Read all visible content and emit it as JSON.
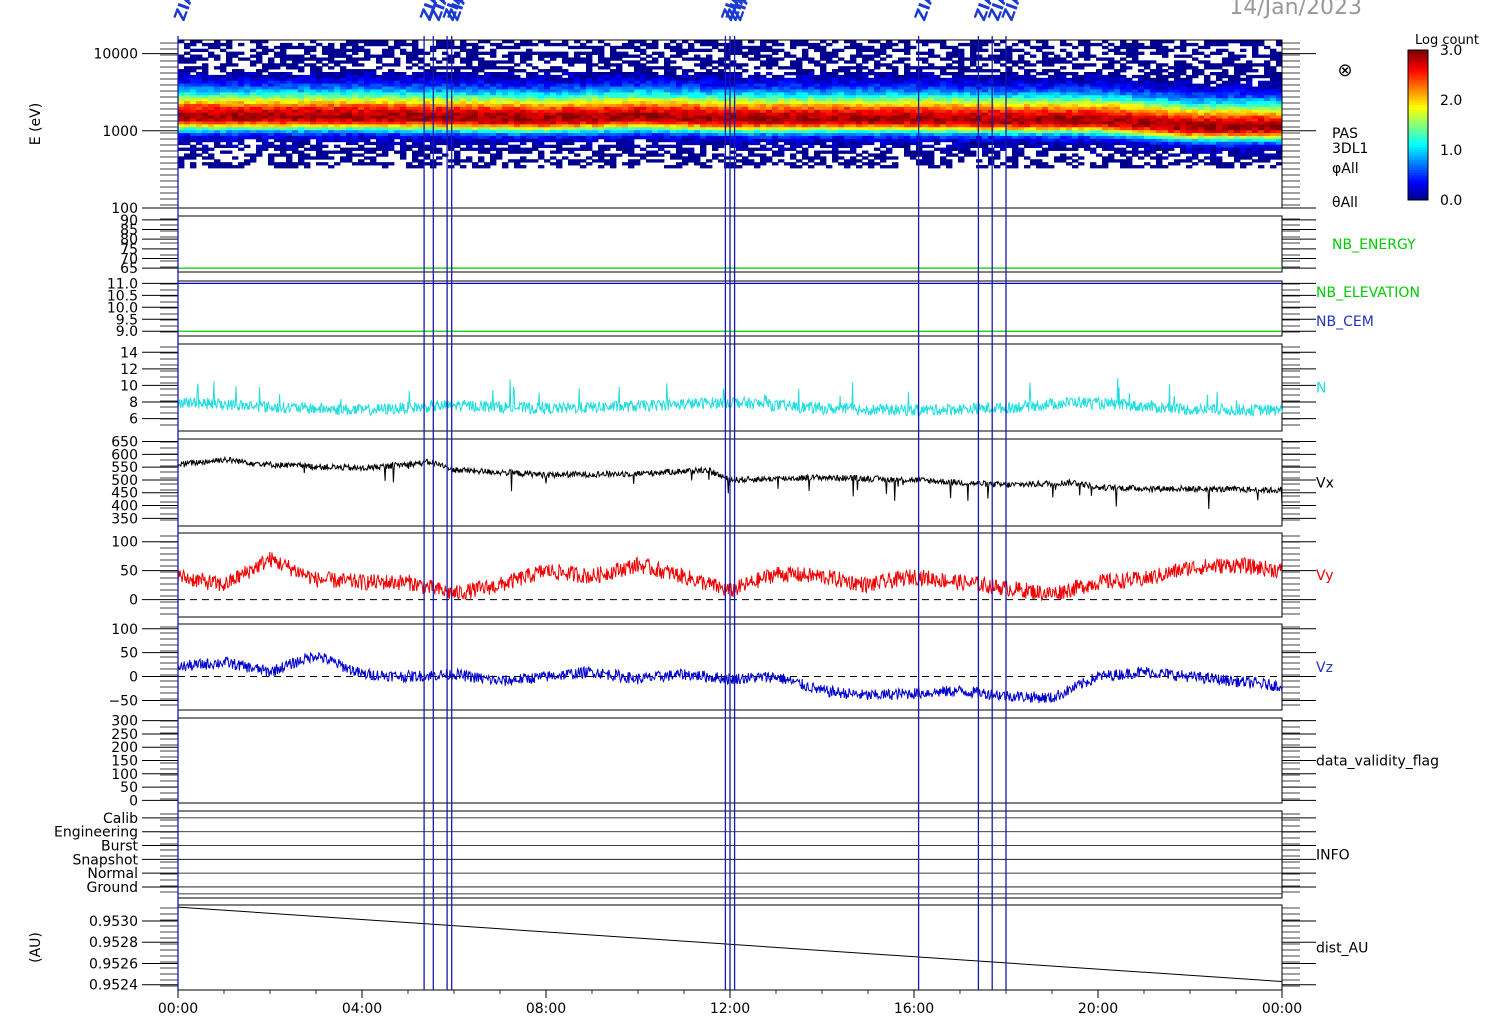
{
  "chart_data": {
    "type": "line",
    "date": "14/Jan/2023",
    "x_ticks": [
      "00:00",
      "04:00",
      "08:00",
      "12:00",
      "16:00",
      "20:00",
      "00:00"
    ],
    "x_range_hours": [
      0,
      24
    ],
    "events": [
      {
        "hour": 0.0,
        "label": "ZIAS"
      },
      {
        "hour": 5.35,
        "label": "ZIAS"
      },
      {
        "hour": 5.55,
        "label": "ZIAS"
      },
      {
        "hour": 5.85,
        "label": "ZIAS"
      },
      {
        "hour": 5.95,
        "label": "ZIAS"
      },
      {
        "hour": 11.9,
        "label": "ZIAS"
      },
      {
        "hour": 12.0,
        "label": "ZIAS"
      },
      {
        "hour": 12.1,
        "label": "ZIAS"
      },
      {
        "hour": 16.1,
        "label": "ZIAS"
      },
      {
        "hour": 17.4,
        "label": "ZIAS"
      },
      {
        "hour": 17.7,
        "label": "ZIAS"
      },
      {
        "hour": 18.0,
        "label": "ZIAS"
      }
    ],
    "colorbar": {
      "title": "Log count",
      "ticks": [
        "3.0",
        "2.0",
        "1.0",
        "0.0"
      ],
      "range": [
        0,
        3
      ]
    },
    "panels": [
      {
        "id": "spectrogram",
        "type": "heatmap",
        "ylabel": "E (eV)",
        "scale": "log",
        "ylim": [
          100,
          15000
        ],
        "ticks": [
          {
            "v": 10000,
            "t": "10000"
          },
          {
            "v": 1000,
            "t": "1000"
          },
          {
            "v": 100,
            "t": "100"
          }
        ],
        "peak_energy_ev": [
          1500,
          1500,
          1500,
          1450,
          1400,
          1500,
          1400,
          1400,
          1400,
          1350,
          1350,
          1100,
          1100
        ],
        "right_labels": [
          "PAS",
          "3DL1",
          "φAll",
          "θAll"
        ],
        "icon": "⊗"
      },
      {
        "id": "nb_energy",
        "ylim": [
          63,
          92
        ],
        "ticks": [
          {
            "v": 90,
            "t": "90"
          },
          {
            "v": 85,
            "t": "85"
          },
          {
            "v": 80,
            "t": "80"
          },
          {
            "v": 75,
            "t": "75"
          },
          {
            "v": 70,
            "t": "70"
          },
          {
            "v": 65,
            "t": "65"
          }
        ],
        "series": [
          {
            "name": "NB_ENERGY",
            "color": "#00cc00",
            "constant": 65
          }
        ],
        "right_labels": [
          {
            "text": "NB_ENERGY",
            "color": "#00cc00"
          }
        ]
      },
      {
        "id": "nb_elev",
        "ylim": [
          8.8,
          11.1
        ],
        "ticks": [
          {
            "v": 11.0,
            "t": "11.0"
          },
          {
            "v": 10.5,
            "t": "10.5"
          },
          {
            "v": 10.0,
            "t": "10.0"
          },
          {
            "v": 9.5,
            "t": "9.5"
          },
          {
            "v": 9.0,
            "t": "9.0"
          }
        ],
        "series": [
          {
            "name": "NB_ELEVATION",
            "color": "#00cc00",
            "constant": 9.0
          },
          {
            "name": "NB_CEM",
            "color": "#0000cc",
            "constant": 11.0
          }
        ],
        "right_labels": [
          {
            "text": "NB_ELEVATION",
            "color": "#00cc00"
          },
          {
            "text": "NB_CEM",
            "color": "#2233bb"
          }
        ]
      },
      {
        "id": "density",
        "ylim": [
          4.5,
          15
        ],
        "ticks": [
          {
            "v": 14,
            "t": "14"
          },
          {
            "v": 12,
            "t": "12"
          },
          {
            "v": 10,
            "t": "10"
          },
          {
            "v": 8,
            "t": "8"
          },
          {
            "v": 6,
            "t": "6"
          }
        ],
        "series": [
          {
            "name": "N",
            "color": "#22dddd",
            "hours": [
              0,
              2,
              4,
              6,
              8,
              10,
              12,
              14,
              16,
              18,
              19.5,
              22,
              24
            ],
            "values": [
              8.0,
              7.4,
              7.0,
              7.6,
              7.2,
              7.5,
              8.0,
              7.2,
              7.0,
              7.3,
              8.0,
              7.1,
              7.0
            ],
            "noise": 0.7,
            "spikes": 2.5
          }
        ],
        "right_labels": [
          {
            "text": "N",
            "color": "#22dddd"
          }
        ]
      },
      {
        "id": "vx",
        "ylim": [
          320,
          660
        ],
        "ticks": [
          {
            "v": 650,
            "t": "650"
          },
          {
            "v": 600,
            "t": "600"
          },
          {
            "v": 550,
            "t": "550"
          },
          {
            "v": 500,
            "t": "500"
          },
          {
            "v": 450,
            "t": "450"
          },
          {
            "v": 400,
            "t": "400"
          },
          {
            "v": 350,
            "t": "350"
          }
        ],
        "series": [
          {
            "name": "Vx",
            "color": "#000000",
            "hours": [
              0,
              1,
              2,
              4,
              5.5,
              6,
              8,
              10,
              11.5,
              12,
              14,
              16,
              18,
              19.5,
              20,
              22,
              24
            ],
            "values": [
              560,
              580,
              560,
              545,
              570,
              540,
              520,
              525,
              540,
              500,
              510,
              500,
              480,
              490,
              470,
              465,
              460
            ],
            "noise": 12,
            "spikes": -60
          }
        ],
        "right_labels": [
          {
            "text": "Vx",
            "color": "#000000"
          }
        ]
      },
      {
        "id": "vy",
        "ylim": [
          -30,
          115
        ],
        "zero_line": true,
        "ticks": [
          {
            "v": 100,
            "t": "100"
          },
          {
            "v": 50,
            "t": "50"
          },
          {
            "v": 0,
            "t": "0"
          }
        ],
        "series": [
          {
            "name": "Vy",
            "color": "#ee0000",
            "hours": [
              0,
              1,
              2,
              3,
              4,
              5,
              6,
              7,
              8,
              9,
              10,
              11,
              12,
              13,
              14,
              15,
              16,
              17,
              18,
              19,
              20,
              21,
              22,
              23,
              24
            ],
            "values": [
              40,
              25,
              70,
              35,
              30,
              30,
              10,
              25,
              50,
              40,
              60,
              40,
              15,
              45,
              40,
              25,
              40,
              30,
              20,
              10,
              30,
              35,
              55,
              60,
              50
            ],
            "noise": 14,
            "spikes": 0
          }
        ],
        "right_labels": [
          {
            "text": "Vy",
            "color": "#ee0000"
          }
        ]
      },
      {
        "id": "vz",
        "ylim": [
          -70,
          110
        ],
        "zero_line": true,
        "ticks": [
          {
            "v": 100,
            "t": "100"
          },
          {
            "v": 50,
            "t": "50"
          },
          {
            "v": 0,
            "t": "0"
          },
          {
            "v": -50,
            "t": "−50"
          }
        ],
        "series": [
          {
            "name": "Vz",
            "color": "#0000cc",
            "hours": [
              0,
              1,
              2,
              3,
              4,
              5,
              6,
              7,
              8,
              9,
              10,
              11,
              12,
              13,
              14,
              15,
              16,
              17,
              18,
              19,
              20,
              21,
              22,
              23,
              24
            ],
            "values": [
              20,
              30,
              10,
              45,
              5,
              0,
              5,
              -10,
              0,
              10,
              -5,
              5,
              -5,
              0,
              -30,
              -40,
              -35,
              -30,
              -40,
              -45,
              0,
              10,
              0,
              -10,
              -20
            ],
            "noise": 12,
            "spikes": 0
          }
        ],
        "right_labels": [
          {
            "text": "Vz",
            "color": "#2233bb"
          }
        ]
      },
      {
        "id": "dvf",
        "ylim": [
          -10,
          310
        ],
        "ticks": [
          {
            "v": 300,
            "t": "300"
          },
          {
            "v": 250,
            "t": "250"
          },
          {
            "v": 200,
            "t": "200"
          },
          {
            "v": 150,
            "t": "150"
          },
          {
            "v": 100,
            "t": "100"
          },
          {
            "v": 50,
            "t": "50"
          },
          {
            "v": 0,
            "t": "0"
          }
        ],
        "series": [],
        "right_labels": [
          {
            "text": "data_validity_flag",
            "color": "#000000"
          }
        ]
      },
      {
        "id": "info",
        "ylim": [
          -0.8,
          5.5
        ],
        "grid": true,
        "ticks": [
          {
            "v": 5,
            "t": "Calib"
          },
          {
            "v": 4,
            "t": "Engineering"
          },
          {
            "v": 3,
            "t": "Burst"
          },
          {
            "v": 2,
            "t": "Snapshot"
          },
          {
            "v": 1,
            "t": "Normal"
          },
          {
            "v": 0,
            "t": "Ground"
          }
        ],
        "series": [],
        "right_labels": [
          {
            "text": "INFO",
            "color": "#000000"
          }
        ]
      },
      {
        "id": "dist",
        "ylabel": "(AU)",
        "ylim": [
          0.95235,
          0.95315
        ],
        "ticks": [
          {
            "v": 0.953,
            "t": "0.9530"
          },
          {
            "v": 0.9528,
            "t": "0.9528"
          },
          {
            "v": 0.9526,
            "t": "0.9526"
          },
          {
            "v": 0.9524,
            "t": "0.9524"
          }
        ],
        "series": [
          {
            "name": "dist_AU",
            "color": "#000000",
            "hours": [
              0,
              24
            ],
            "values": [
              0.95313,
              0.95243
            ],
            "noise": 0,
            "spikes": 0
          }
        ],
        "right_labels": [
          {
            "text": "dist_AU",
            "color": "#000000"
          }
        ]
      }
    ]
  }
}
